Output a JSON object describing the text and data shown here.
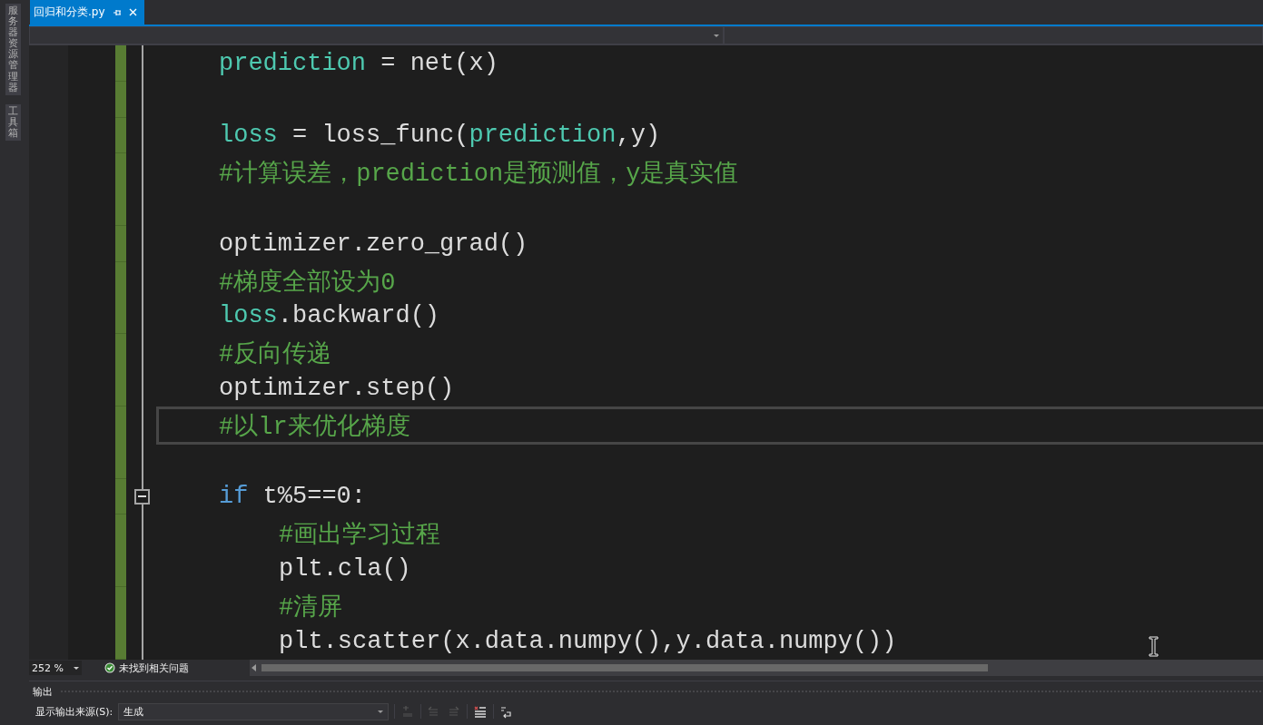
{
  "sidebar": {
    "tabs": [
      {
        "label": "服务器资源管理器"
      },
      {
        "label": "工具箱"
      }
    ]
  },
  "document_tabs": [
    {
      "label": "回归和分类.py",
      "selected": true
    }
  ],
  "editor": {
    "lines": [
      {
        "kind": "code",
        "current": false,
        "tokens": [
          {
            "text": "prediction",
            "kind": "type"
          },
          {
            "text": " = net(x)",
            "kind": "plain"
          }
        ]
      },
      {
        "kind": "blank",
        "current": false
      },
      {
        "kind": "code",
        "current": false,
        "tokens": [
          {
            "text": "loss",
            "kind": "type"
          },
          {
            "text": " = loss_func(",
            "kind": "plain"
          },
          {
            "text": "prediction",
            "kind": "type"
          },
          {
            "text": ",y)",
            "kind": "plain"
          }
        ]
      },
      {
        "kind": "code",
        "current": false,
        "tokens": [
          {
            "text": "#计算误差，prediction是预测值，y是真实值",
            "kind": "comment"
          }
        ]
      },
      {
        "kind": "blank",
        "current": false
      },
      {
        "kind": "code",
        "current": false,
        "tokens": [
          {
            "text": "optimizer.zero_grad()",
            "kind": "plain"
          }
        ]
      },
      {
        "kind": "code",
        "current": false,
        "tokens": [
          {
            "text": "#梯度全部设为0",
            "kind": "comment"
          }
        ]
      },
      {
        "kind": "code",
        "current": false,
        "tokens": [
          {
            "text": "loss",
            "kind": "type"
          },
          {
            "text": ".backward()",
            "kind": "plain"
          }
        ]
      },
      {
        "kind": "code",
        "current": false,
        "tokens": [
          {
            "text": "#反向传递",
            "kind": "comment"
          }
        ]
      },
      {
        "kind": "code",
        "current": false,
        "tokens": [
          {
            "text": "optimizer.step()",
            "kind": "plain"
          }
        ]
      },
      {
        "kind": "code",
        "current": true,
        "tokens": [
          {
            "text": "#以lr来优化梯度",
            "kind": "comment"
          }
        ]
      },
      {
        "kind": "blank",
        "current": false
      },
      {
        "kind": "code",
        "current": false,
        "expanded": true,
        "tokens": [
          {
            "text": "if",
            "kind": "keyword"
          },
          {
            "text": " t%5==0:",
            "kind": "plain"
          }
        ],
        "children": [
          {
            "kind": "code",
            "current": false,
            "tokens": [
              {
                "text": "#画出学习过程",
                "kind": "comment"
              }
            ]
          },
          {
            "kind": "code",
            "current": false,
            "tokens": [
              {
                "text": "plt.cla()",
                "kind": "plain"
              }
            ]
          },
          {
            "kind": "code",
            "current": false,
            "tokens": [
              {
                "text": "#清屏",
                "kind": "comment"
              }
            ]
          },
          {
            "kind": "code",
            "current": false,
            "tokens": [
              {
                "text": "plt.scatter(x.data.numpy(),y.data.numpy())",
                "kind": "plain"
              }
            ]
          }
        ]
      }
    ]
  },
  "status_bar": {
    "zoom": "252 %",
    "issues": "未找到相关问题"
  },
  "output_panel": {
    "title": "输出",
    "source_label": "显示输出来源(S):",
    "source_value": "生成"
  }
}
